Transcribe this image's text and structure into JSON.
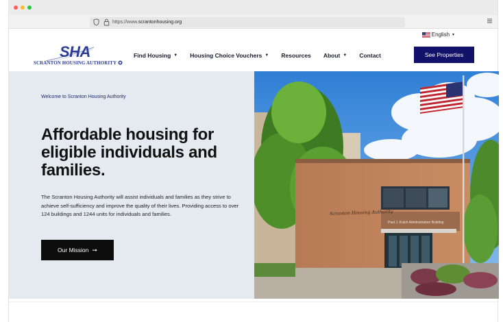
{
  "browser": {
    "url_prefix": "https://www.",
    "url_domain": "scrantonhousing.org"
  },
  "language": {
    "label": "English",
    "caret": "▼"
  },
  "logo": {
    "mark": "SHA",
    "name": "Scranton Housing Authority"
  },
  "nav": {
    "items": [
      {
        "label": "Find Housing",
        "has_dropdown": true
      },
      {
        "label": "Housing Choice Vouchers",
        "has_dropdown": true
      },
      {
        "label": "Resources",
        "has_dropdown": false
      },
      {
        "label": "About",
        "has_dropdown": true
      },
      {
        "label": "Contact",
        "has_dropdown": false
      }
    ],
    "cta_label": "See Properties"
  },
  "hero": {
    "eyebrow": "Welcome to Scranton Housing Authority",
    "headline": "Affordable housing for eligible individuals and families.",
    "body": "The Scranton Housing Authority will assist individuals and families as they strive to achieve self-sufficiency and improve the quality of their lives. Providing access to over 124 buildings and 1244 units for individuals and families.",
    "button_label": "Our Mission",
    "button_arrow": "➞",
    "building_sign": "Paul J. Kutch Administration Building",
    "building_script": "Scranton Housing Authority"
  },
  "colors": {
    "brand": "#2a3b9a",
    "cta": "#12126b",
    "hero_bg": "#e5e9f0"
  }
}
